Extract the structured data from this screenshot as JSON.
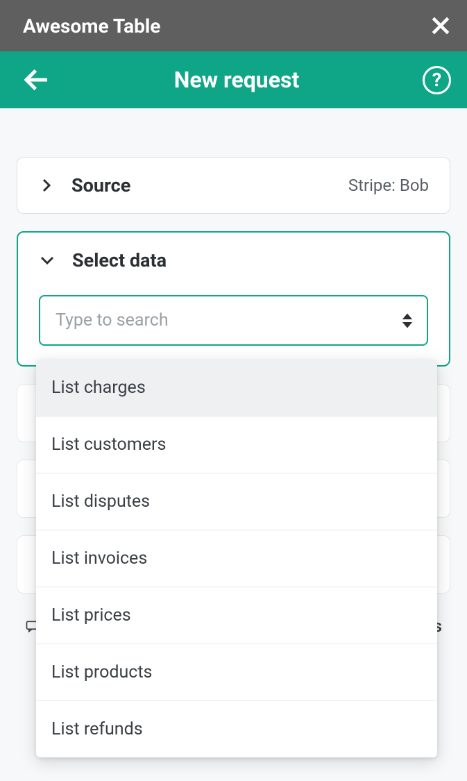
{
  "titleBar": {
    "title": "Awesome Table"
  },
  "header": {
    "title": "New request"
  },
  "source": {
    "label": "Source",
    "value": "Stripe: Bob"
  },
  "selectData": {
    "label": "Select data",
    "searchPlaceholder": "Type to search"
  },
  "dropdown": {
    "items": [
      "List charges",
      "List customers",
      "List disputes",
      "List invoices",
      "List prices",
      "List products",
      "List refunds"
    ]
  },
  "footer": {
    "trailing": "gs"
  }
}
